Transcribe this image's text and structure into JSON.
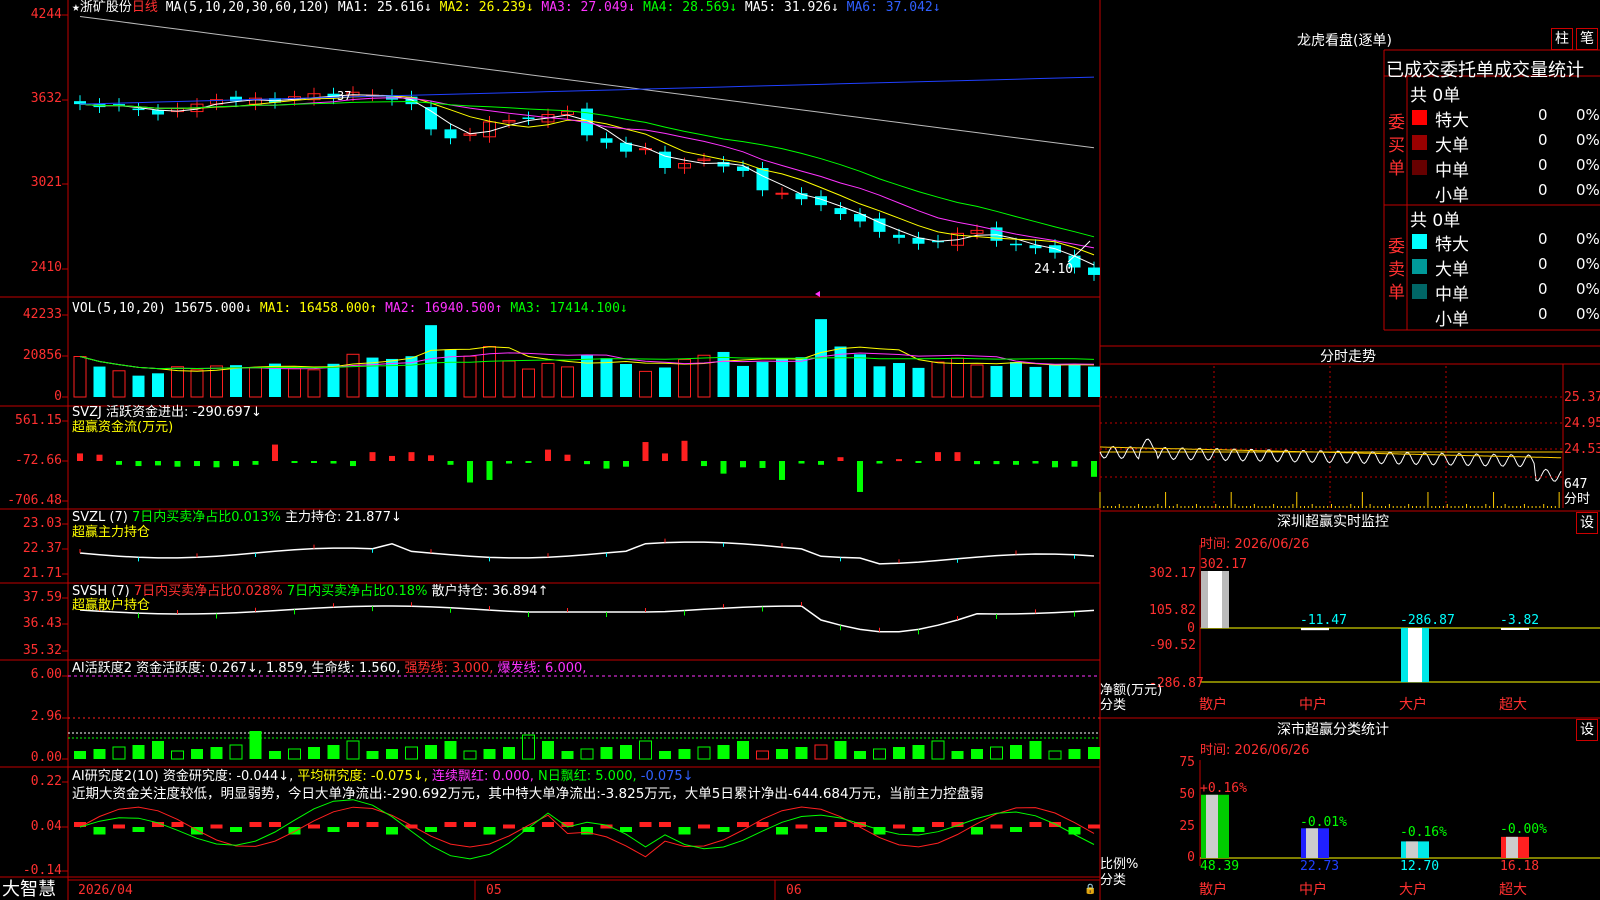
{
  "main": {
    "star": "★",
    "name": "浙矿股份",
    "period": "日线",
    "ma_def": "MA(5,10,20,30,60,120)",
    "ma1": "MA1: 25.616↓",
    "ma2": "MA2: 26.239↓",
    "ma3": "MA3: 27.049↓",
    "ma4": "MA4: 28.569↓",
    "ma5": "MA5: 31.926↓",
    "ma6": "MA6: 37.042↓",
    "low_label": "24.10",
    "hi_label": "37",
    "ticks": [
      "4244",
      "3632",
      "3021",
      "2410"
    ]
  },
  "vol": {
    "def": "VOL(5,10,20)",
    "val": "15675.000↓",
    "ma1": "MA1: 16458.000↑",
    "ma2": "MA2: 16940.500↑",
    "ma3": "MA3: 17414.100↓",
    "ticks": [
      "42233",
      "20856",
      "0"
    ]
  },
  "svzj": {
    "head": "SVZJ  活跃资金进出: -290.697↓",
    "sub": "超赢资金流(万元)",
    "ticks": [
      "561.15",
      "-72.66",
      "-706.48"
    ]
  },
  "svzl": {
    "head1": "SVZL (7)",
    "head2": "7日内买卖净占比0.013%",
    "head3": "主力持仓: 21.877↓",
    "sub": "超赢主力持仓",
    "ticks": [
      "23.03",
      "22.37",
      "21.71"
    ]
  },
  "svsh": {
    "head1": "SVSH (7)",
    "head2": "7日内买卖净占比0.028%",
    "head3": "7日内买卖净占比0.18%",
    "head4": "散户持仓: 36.894↑",
    "sub": "超赢散户持仓",
    "ticks": [
      "37.59",
      "36.43",
      "35.32"
    ]
  },
  "ai1": {
    "head1": "AI活跃度2",
    "head2": "资金活跃度: 0.267↓, 1.859, 生命线: 1.560,",
    "head3": "强势线: 3.000,",
    "head4": "爆发线: 6.000,",
    "ticks": [
      "6.00",
      "2.96",
      "0.00"
    ]
  },
  "ai2": {
    "h1": "AI研究度2(10)",
    "h2": "资金研究度: -0.044↓,",
    "h3": "平均研究度: -0.075↓,",
    "h4": "连续飘红: 0.000,",
    "h5": "N日飘红: 5.000,",
    "h6": "-0.075↓",
    "note": "近期大资金关注度较低，明显弱势，今日大单净流出:-290.692万元，其中特大单净流出:-3.825万元，大单5日累计净出-644.684万元，当前主力控盘弱",
    "ticks": [
      "0.22",
      "0.04",
      "-0.14"
    ]
  },
  "dates": {
    "d1": "2026/04",
    "d2": "05",
    "d3": "06"
  },
  "brand": "大智慧",
  "dragon": {
    "title": "龙虎看盘(逐单)",
    "btn1": "柱",
    "btn2": "笔",
    "header": "已成交委托单成交量统计",
    "buy_label": "委买单",
    "sell_label": "委卖单",
    "buy_total": "共 0单",
    "sell_total": "共 0单",
    "buy_rows": [
      {
        "name": "特大",
        "n": "0",
        "p": "0%"
      },
      {
        "name": "大单",
        "n": "0",
        "p": "0%"
      },
      {
        "name": "中单",
        "n": "0",
        "p": "0%"
      },
      {
        "name": "小单",
        "n": "0",
        "p": "0%"
      }
    ],
    "sell_rows": [
      {
        "name": "特大",
        "n": "0",
        "p": "0%"
      },
      {
        "name": "大单",
        "n": "0",
        "p": "0%"
      },
      {
        "name": "中单",
        "n": "0",
        "p": "0%"
      },
      {
        "name": "小单",
        "n": "0",
        "p": "0%"
      }
    ]
  },
  "intraday": {
    "title": "分时走势",
    "ticks": [
      "25.37",
      "24.95",
      "24.53"
    ],
    "vol_tick": "647",
    "vol_label": "分时"
  },
  "sz_monitor": {
    "title": "深圳超赢实时监控",
    "btn": "设",
    "time": "时间: 2026/06/26",
    "ticks": [
      "302.17",
      "105.82",
      "0",
      "-90.52",
      "-286.87"
    ],
    "ylabel": "净额(万元)",
    "xlabel": "分类",
    "categories": [
      "散户",
      "中户",
      "大户",
      "超大"
    ],
    "values": [
      "302.17",
      "-11.47",
      "-286.87",
      "-3.82"
    ]
  },
  "sz_class": {
    "title": "深市超赢分类统计",
    "btn": "设",
    "time": "时间: 2026/06/26",
    "ticks": [
      "75",
      "50",
      "25",
      "0"
    ],
    "ylabel": "比例%",
    "xlabel": "分类",
    "categories": [
      "散户",
      "中户",
      "大户",
      "超大"
    ],
    "values": [
      "48.39",
      "22.73",
      "12.70",
      "16.18"
    ],
    "changes": [
      "+0.16%",
      "-0.01%",
      "-0.16%",
      "-0.00%"
    ]
  },
  "colors": {
    "up": "#ff2020",
    "down": "#00ffff",
    "bg": "#000000",
    "border": "#cc0000"
  },
  "chart_data": [
    {
      "type": "candlestick",
      "title": "浙矿股份 日线",
      "series": [
        {
          "name": "MA1",
          "last": 25.616
        },
        {
          "name": "MA2",
          "last": 26.239
        },
        {
          "name": "MA3",
          "last": 27.049
        },
        {
          "name": "MA4",
          "last": 28.569
        },
        {
          "name": "MA5",
          "last": 31.926
        },
        {
          "name": "MA6",
          "last": 37.042
        }
      ],
      "close": [
        35.6,
        35.4,
        35.5,
        35.2,
        34.9,
        35.3,
        35.6,
        35.9,
        35.8,
        36.0,
        35.7,
        36.1,
        36.3,
        36.0,
        36.4,
        36.2,
        35.9,
        35.6,
        33.9,
        33.3,
        33.6,
        34.4,
        34.5,
        34.6,
        34.9,
        35.1,
        33.5,
        33.0,
        32.4,
        32.6,
        31.3,
        31.6,
        31.9,
        31.4,
        31.1,
        29.8,
        29.6,
        29.2,
        28.8,
        28.2,
        27.7,
        27.0,
        26.6,
        26.2,
        26.3,
        26.9,
        27.1,
        26.4,
        26.1,
        25.9,
        25.6,
        24.6,
        24.1
      ],
      "ylim": [
        23.5,
        42.5
      ]
    },
    {
      "type": "bar",
      "title": "VOL(5,10,20)",
      "values": [
        20856,
        15675,
        13500,
        11000,
        12200,
        15600,
        14000,
        16000,
        16400,
        15100,
        17200,
        14600,
        14000,
        17100,
        22000,
        20300,
        19600,
        21000,
        37000,
        24500,
        21000,
        26000,
        18500,
        14400,
        17300,
        15500,
        21500,
        20000,
        17000,
        13200,
        15200,
        19300,
        21500,
        23200,
        16000,
        18000,
        20000,
        20500,
        40100,
        26000,
        22000,
        15800,
        17500,
        15000,
        18000,
        20000,
        16500,
        16000,
        18000,
        15500,
        16500,
        17000,
        15675
      ],
      "ylim": [
        0,
        42233
      ]
    },
    {
      "type": "bar",
      "title": "超赢资金流(万元)",
      "values": [
        120,
        100,
        -60,
        -80,
        -70,
        -90,
        -80,
        -100,
        -80,
        -60,
        260,
        -30,
        -10,
        -40,
        -80,
        140,
        80,
        140,
        90,
        -60,
        -340,
        -300,
        -40,
        -10,
        180,
        100,
        -50,
        -120,
        -90,
        300,
        120,
        320,
        -80,
        -200,
        -100,
        -110,
        -300,
        -40,
        -60,
        60,
        -490,
        -40,
        30,
        -30,
        140,
        140,
        -50,
        -50,
        -60,
        -40,
        -100,
        -90,
        -250
      ],
      "ylim": [
        -706.48,
        561.15
      ]
    },
    {
      "type": "line",
      "title": "超赢主力持仓",
      "ylim": [
        21.71,
        23.03
      ],
      "last": 21.877
    },
    {
      "type": "line",
      "title": "超赢散户持仓",
      "ylim": [
        35.32,
        37.59
      ],
      "last": 36.894
    },
    {
      "type": "bar",
      "title": "AI活跃度2",
      "ylim": [
        0,
        6.0
      ],
      "last": 0.267
    },
    {
      "type": "bar",
      "title": "AI研究度2(10)",
      "ylim": [
        -0.14,
        0.22
      ],
      "last": -0.044
    },
    {
      "type": "bar",
      "title": "深圳超赢实时监控",
      "categories": [
        "散户",
        "中户",
        "大户",
        "超大"
      ],
      "values": [
        302.17,
        -11.47,
        -286.87,
        -3.82
      ],
      "ylim": [
        -286.87,
        302.17
      ]
    },
    {
      "type": "bar",
      "title": "深市超赢分类统计",
      "categories": [
        "散户",
        "中户",
        "大户",
        "超大"
      ],
      "values": [
        48.39,
        22.73,
        12.7,
        16.18
      ],
      "ylim": [
        0,
        75
      ]
    }
  ]
}
